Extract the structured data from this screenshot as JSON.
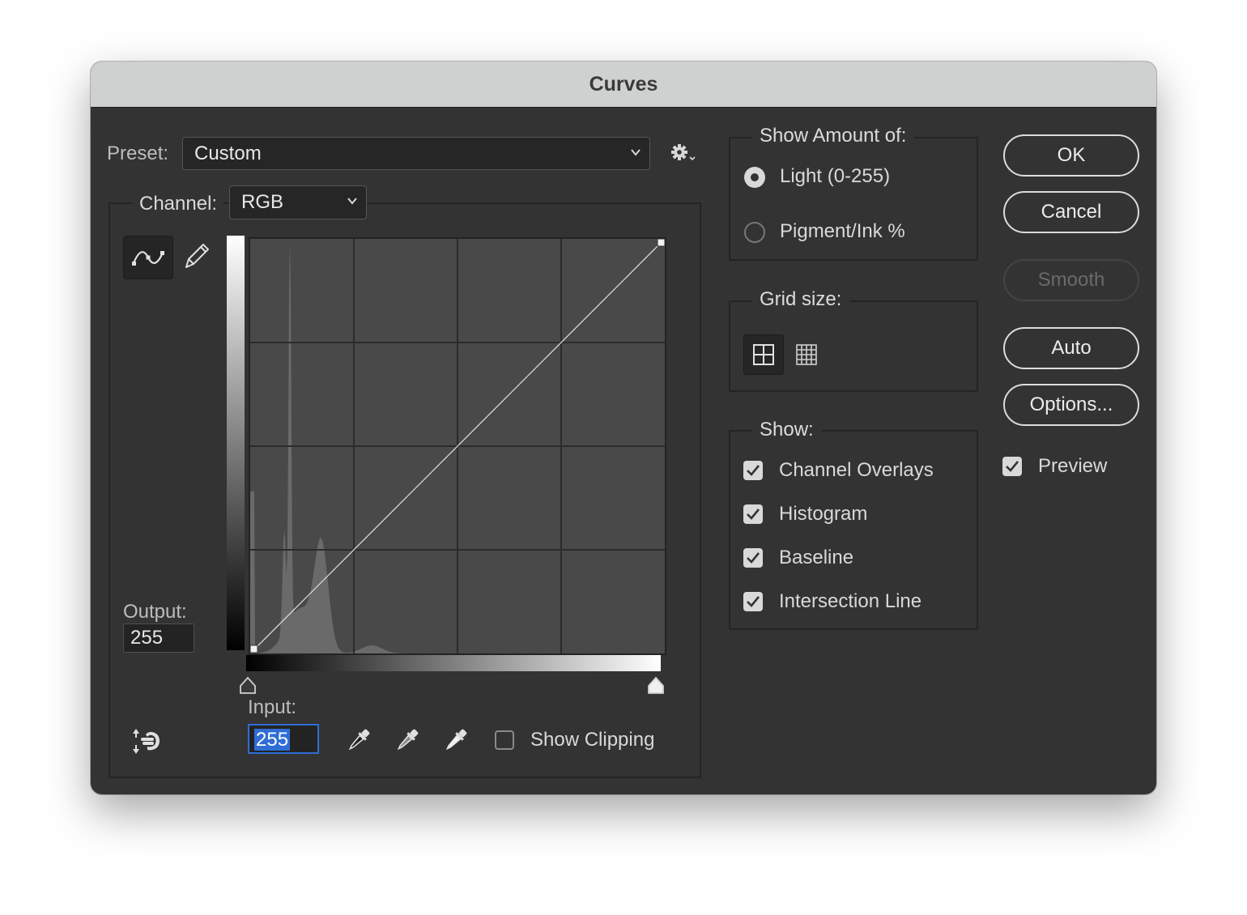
{
  "window": {
    "title": "Curves"
  },
  "preset": {
    "label": "Preset:",
    "value": "Custom",
    "settings_icon": "gear-icon"
  },
  "channel": {
    "label": "Channel:",
    "value": "RGB"
  },
  "tools": {
    "curve_icon": "curve-tool-icon",
    "pencil_icon": "pencil-icon"
  },
  "output": {
    "label": "Output:",
    "value": "255"
  },
  "input": {
    "label": "Input:",
    "value": "255"
  },
  "eyedroppers": [
    "black-point-eyedropper-icon",
    "gray-point-eyedropper-icon",
    "white-point-eyedropper-icon"
  ],
  "show_clipping": {
    "label": "Show Clipping",
    "checked": false
  },
  "show_amount": {
    "title": "Show Amount of:",
    "options": [
      {
        "label": "Light  (0-255)",
        "selected": true
      },
      {
        "label": "Pigment/Ink %",
        "selected": false
      }
    ]
  },
  "grid_size": {
    "title": "Grid size:",
    "selected": "simple"
  },
  "show": {
    "title": "Show:",
    "items": [
      {
        "label": "Channel Overlays",
        "checked": true
      },
      {
        "label": "Histogram",
        "checked": true
      },
      {
        "label": "Baseline",
        "checked": true
      },
      {
        "label": "Intersection Line",
        "checked": true
      }
    ]
  },
  "buttons": {
    "ok": "OK",
    "cancel": "Cancel",
    "smooth": "Smooth",
    "auto": "Auto",
    "options": "Options..."
  },
  "preview": {
    "label": "Preview",
    "checked": true
  },
  "curve": {
    "points": [
      [
        0,
        0
      ],
      [
        255,
        255
      ]
    ]
  },
  "colors": {
    "panel": "#333333",
    "graph": "#494949",
    "selection": "#2f6dd5",
    "titlebar": "#cfd0d0"
  }
}
